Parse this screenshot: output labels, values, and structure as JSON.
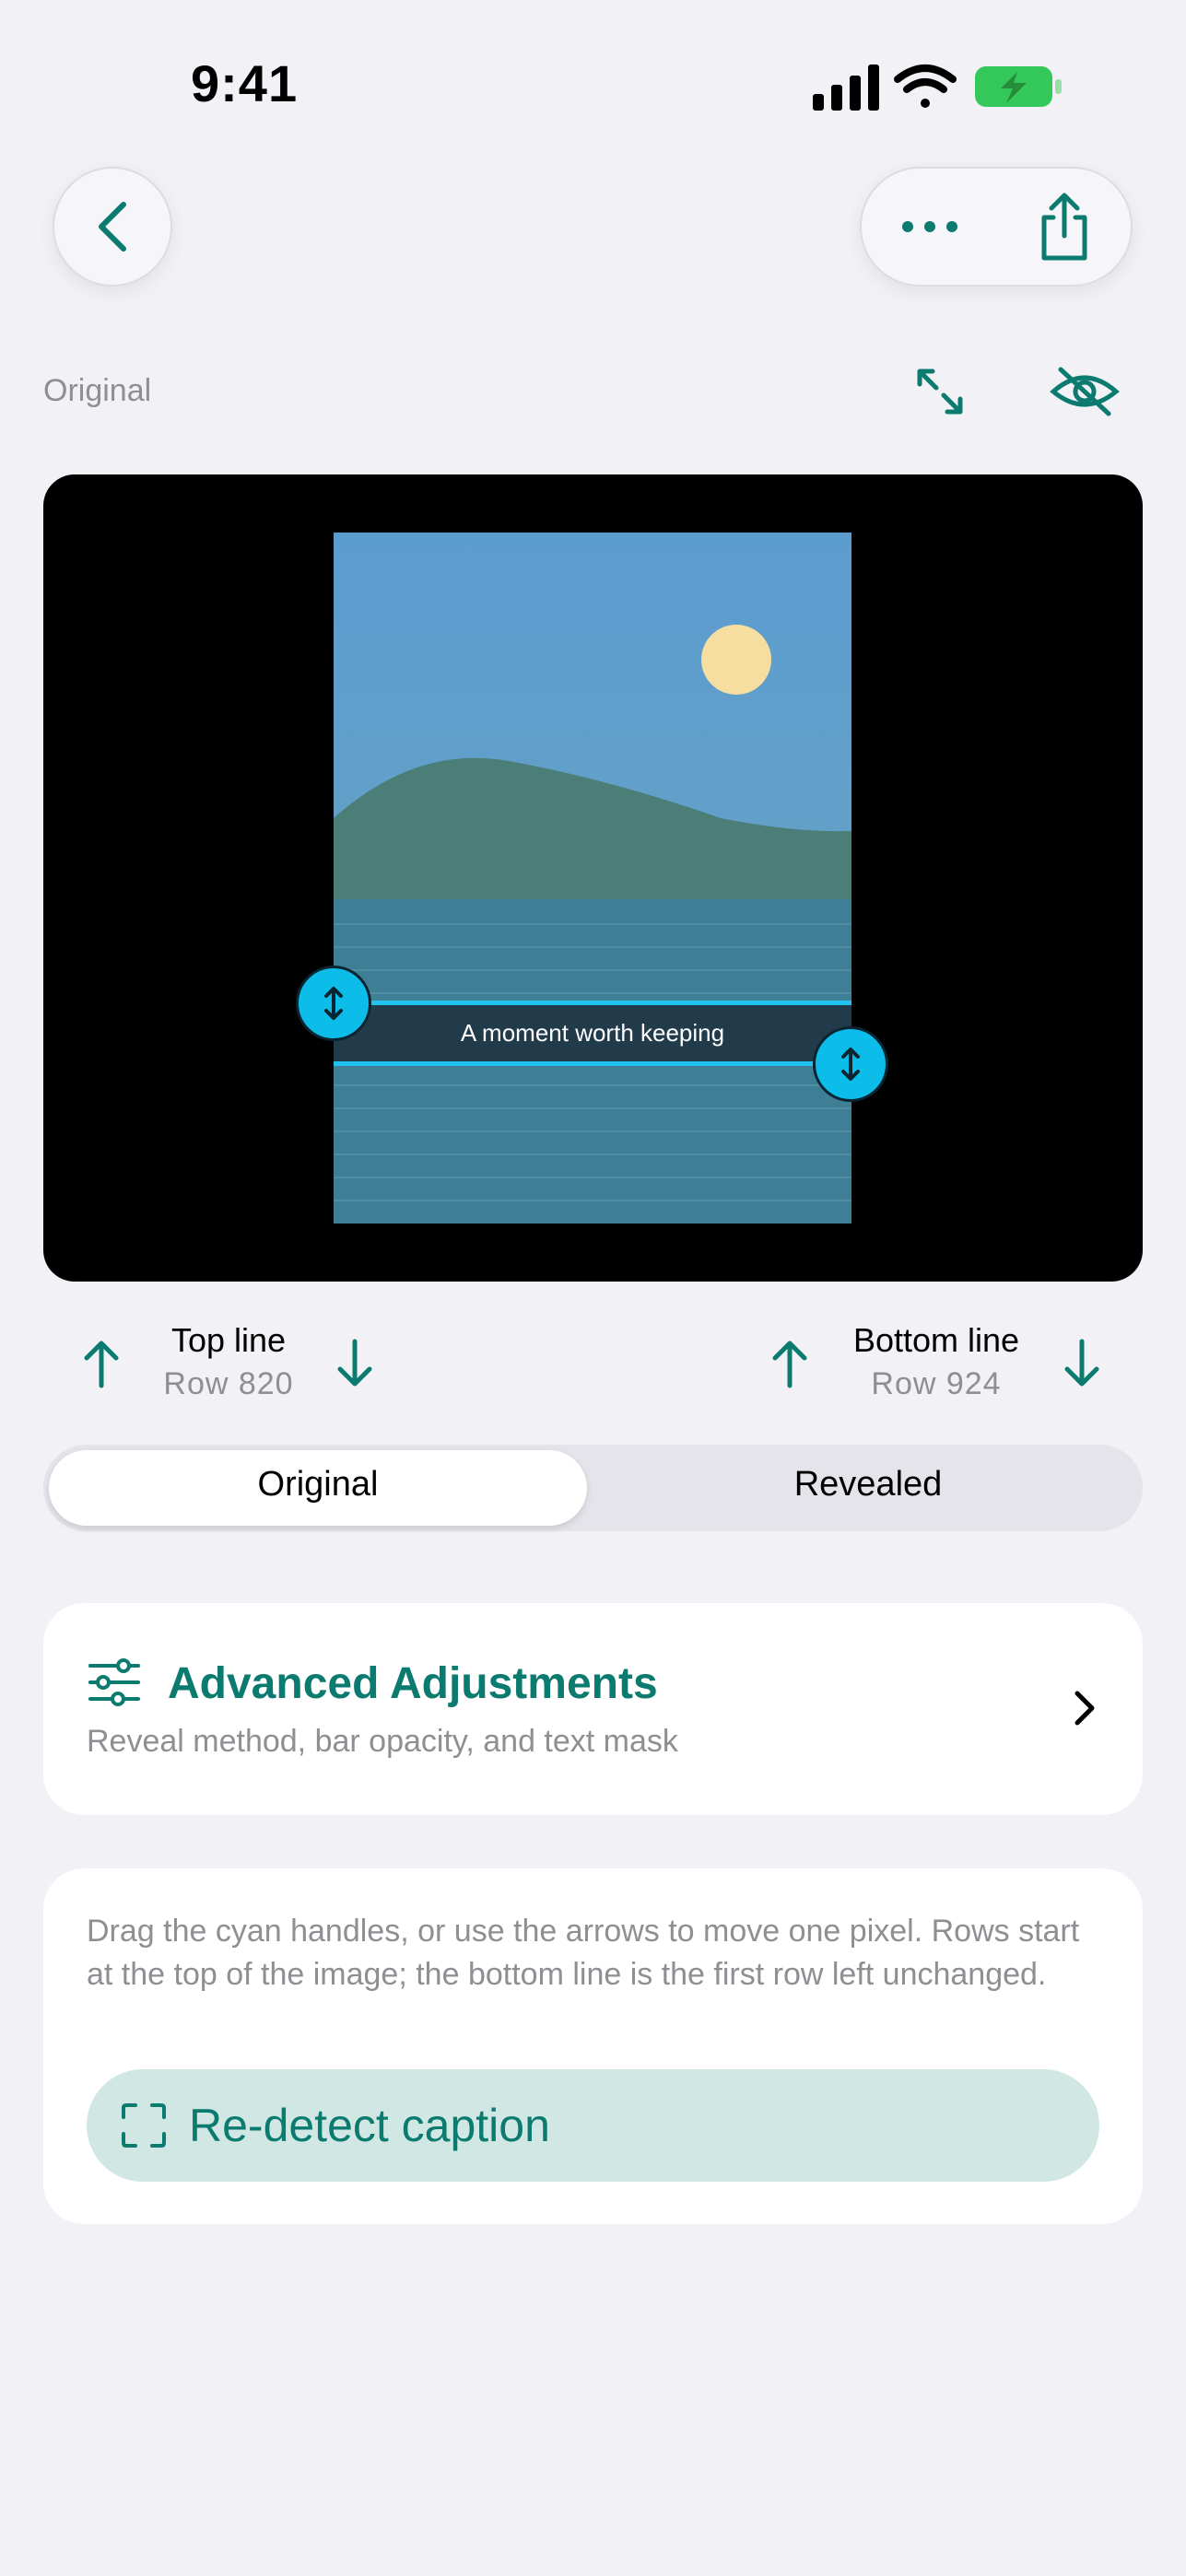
{
  "status_bar": {
    "time": "9:41",
    "battery_color": "#34c759"
  },
  "nav": {
    "back_icon": "chevron-left-icon",
    "more_icon": "ellipsis-icon",
    "share_icon": "share-icon"
  },
  "view": {
    "label": "Original",
    "expand_icon": "expand-icon",
    "hide_icon": "eye-slash-icon"
  },
  "preview": {
    "caption_text": "A moment worth keeping",
    "handle_color": "#0cbce9"
  },
  "lines": {
    "top": {
      "label": "Top line",
      "row": "Row 820"
    },
    "bottom": {
      "label": "Bottom line",
      "row": "Row 924"
    }
  },
  "segmented": {
    "options": [
      "Original",
      "Revealed"
    ],
    "selected": "Original"
  },
  "advanced": {
    "title": "Advanced Adjustments",
    "subtitle": "Reveal method, bar opacity, and text mask"
  },
  "help": {
    "text": "Drag the cyan handles, or use the arrows to move one pixel. Rows start at the top of the image; the bottom line is the first row left unchanged.",
    "redetect_label": "Re-detect caption"
  },
  "colors": {
    "accent": "#0b7a6f",
    "cyan": "#1ec4ef",
    "background": "#f1f1f6"
  }
}
